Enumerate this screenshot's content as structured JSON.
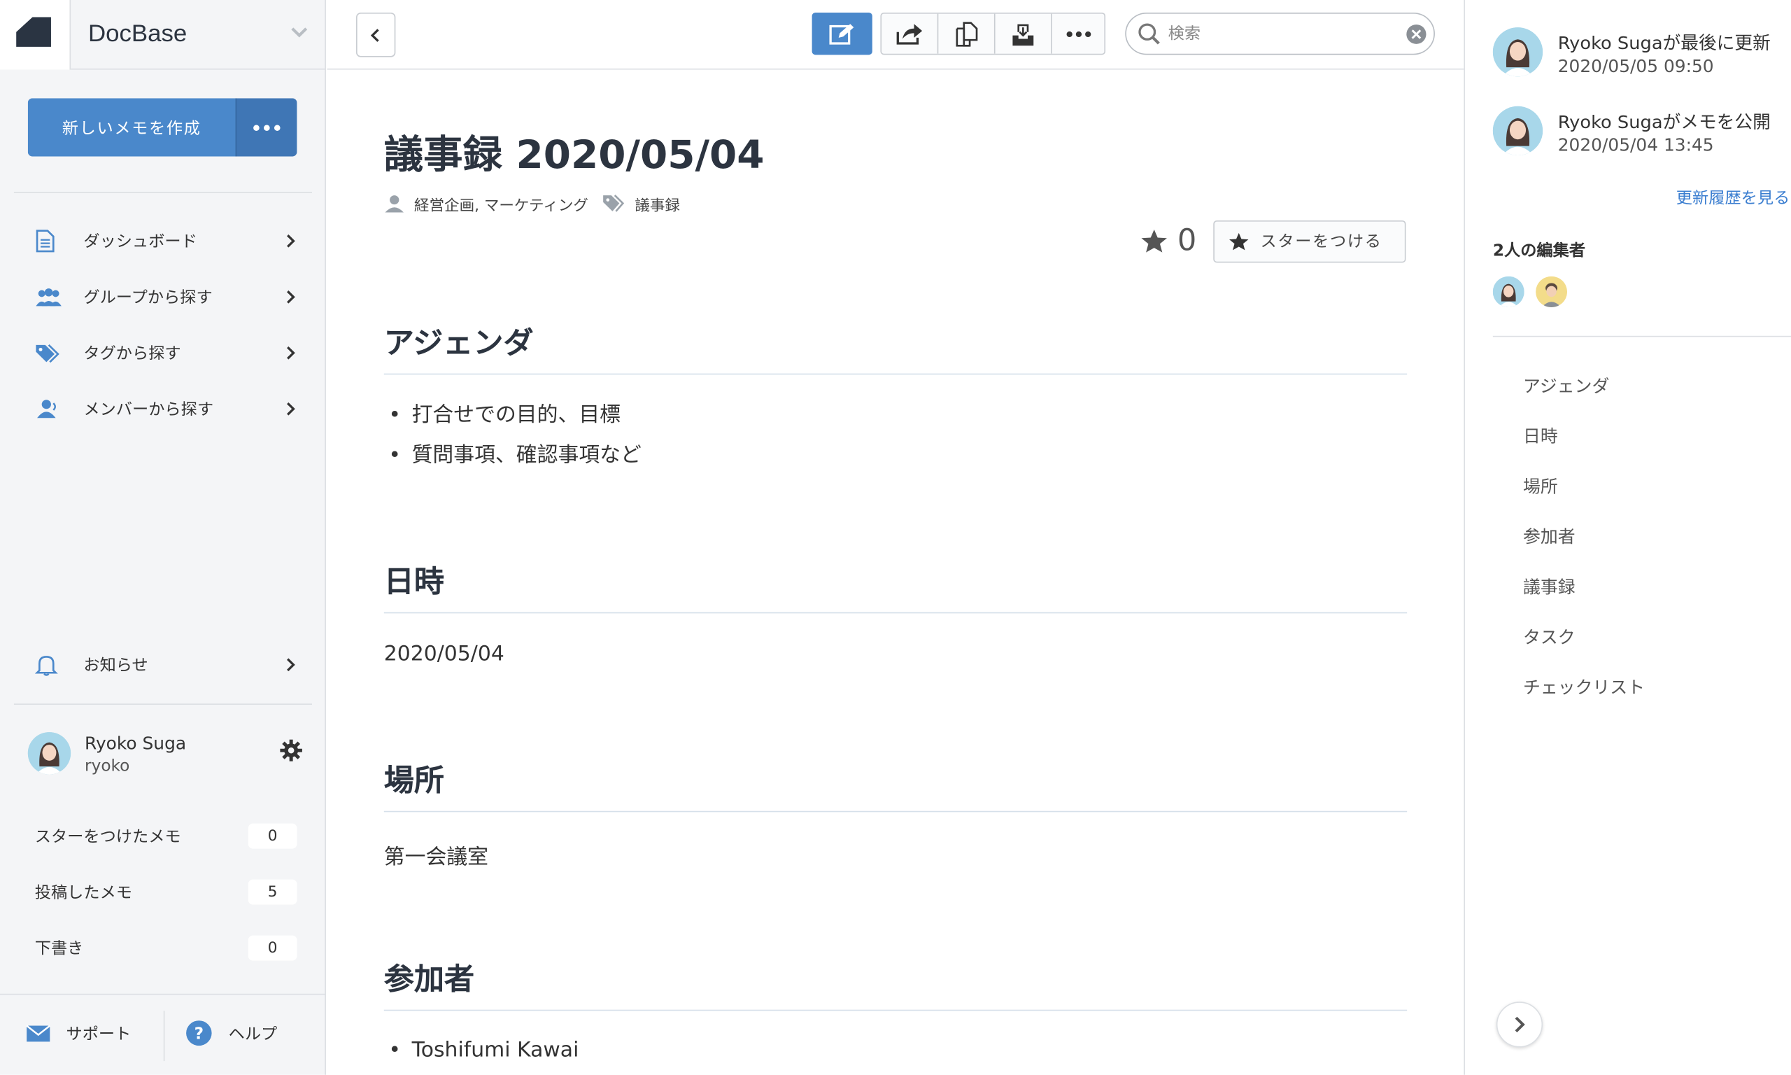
{
  "brand": {
    "name": "DocBase"
  },
  "sidebar": {
    "new_memo_label": "新しいメモを作成",
    "nav": [
      {
        "label": "ダッシュボード",
        "icon": "document-icon"
      },
      {
        "label": "グループから探す",
        "icon": "group-icon"
      },
      {
        "label": "タグから探す",
        "icon": "tag-icon"
      },
      {
        "label": "メンバーから探す",
        "icon": "member-icon"
      }
    ],
    "notifications_label": "お知らせ",
    "user": {
      "name": "Ryoko Suga",
      "id": "ryoko"
    },
    "counts": [
      {
        "label": "スターをつけたメモ",
        "value": "0"
      },
      {
        "label": "投稿したメモ",
        "value": "5"
      },
      {
        "label": "下書き",
        "value": "0"
      }
    ],
    "footer": {
      "support": "サポート",
      "help": "ヘルプ"
    }
  },
  "toolbar": {
    "search_placeholder": "検索"
  },
  "document": {
    "title": "議事録 2020/05/04",
    "groups": "経営企画, マーケティング",
    "tag": "議事録",
    "star_count": "0",
    "star_button": "スターをつける",
    "sections": {
      "agenda": {
        "heading": "アジェンダ",
        "items": [
          "打合せでの目的、目標",
          "質問事項、確認事項など"
        ]
      },
      "datetime": {
        "heading": "日時",
        "text": "2020/05/04"
      },
      "place": {
        "heading": "場所",
        "text": "第一会議室"
      },
      "attendees": {
        "heading": "参加者",
        "items": [
          "Toshifumi Kawai"
        ]
      }
    }
  },
  "right_panel": {
    "activity": [
      {
        "text": "Ryoko Sugaが最後に更新",
        "time": "2020/05/05 09:50"
      },
      {
        "text": "Ryoko Sugaがメモを公開",
        "time": "2020/05/04 13:45"
      }
    ],
    "history_link": "更新履歴を見る",
    "editors_title": "2人の編集者",
    "toc": [
      "アジェンダ",
      "日時",
      "場所",
      "参加者",
      "議事録",
      "タスク",
      "チェックリスト"
    ]
  },
  "colors": {
    "accent": "#4a88cb",
    "link": "#3b7ed0",
    "heading": "#2c3440"
  }
}
